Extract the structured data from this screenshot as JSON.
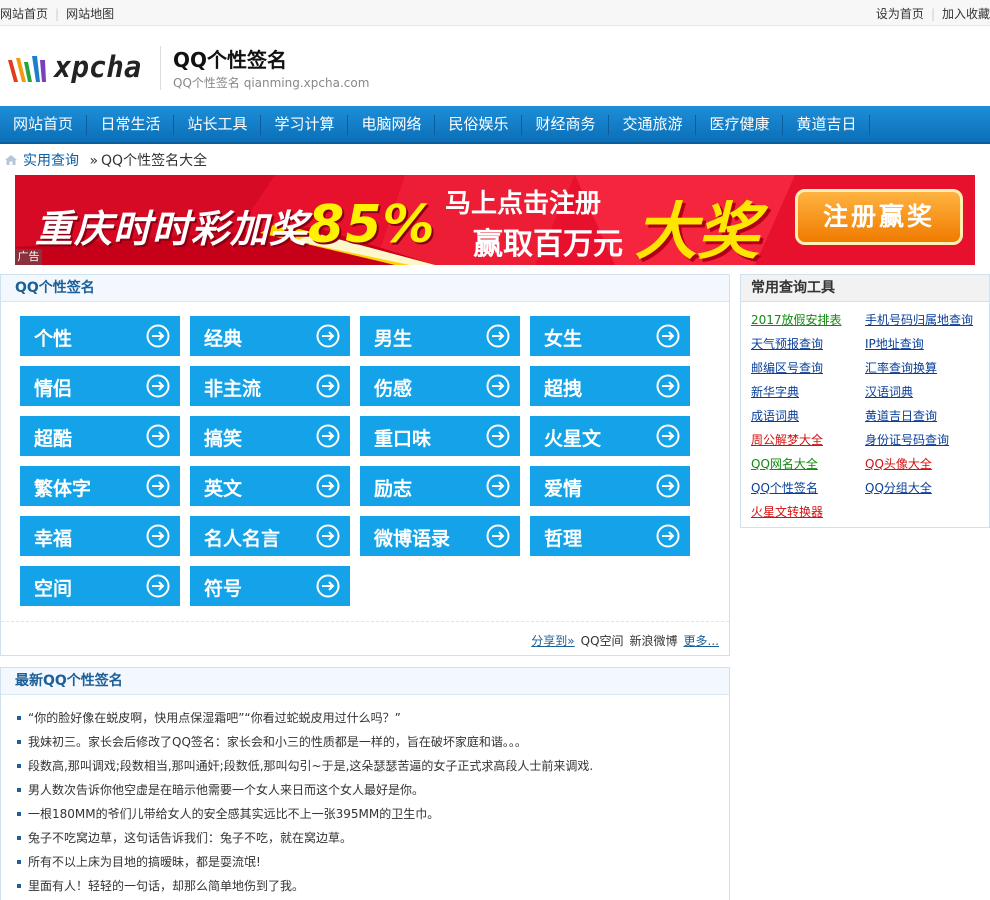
{
  "topbar": {
    "home": "网站首页",
    "sitemap": "网站地图",
    "set_home": "设为首页",
    "favorite": "加入收藏"
  },
  "header": {
    "logo_text": "xpcha",
    "title": "QQ个性签名",
    "subtitle": "QQ个性签名 qianming.xpcha.com"
  },
  "nav": [
    "网站首页",
    "日常生活",
    "站长工具",
    "学习计算",
    "电脑网络",
    "民俗娱乐",
    "财经商务",
    "交通旅游",
    "医疗健康",
    "黄道吉日"
  ],
  "breadcrumb": {
    "root": "实用查询",
    "separator": "»",
    "current": "QQ个性签名大全"
  },
  "ad": {
    "tag": "广告",
    "line1_a": "重庆时时彩加奖",
    "line1_b": "85%",
    "line2": "马上点击注册",
    "line3": "赢取百万元",
    "big": "大奖",
    "button": "注册赢奖"
  },
  "categories_box": {
    "title": "QQ个性签名",
    "items": [
      "个性",
      "经典",
      "男生",
      "女生",
      "情侣",
      "非主流",
      "伤感",
      "超拽",
      "超酷",
      "搞笑",
      "重口味",
      "火星文",
      "繁体字",
      "英文",
      "励志",
      "爱情",
      "幸福",
      "名人名言",
      "微博语录",
      "哲理",
      "空间",
      "符号"
    ],
    "share_to": "分享到»",
    "share_qzone": "QQ空间",
    "share_weibo": "新浪微博",
    "more": "更多..."
  },
  "tools": {
    "title": "常用查询工具",
    "links": [
      {
        "label": "2017放假安排表",
        "color": "#118a11"
      },
      {
        "label": "手机号码归属地查询",
        "color": "#0a3f99"
      },
      {
        "label": "天气预报查询",
        "color": "#0a3f99"
      },
      {
        "label": "IP地址查询",
        "color": "#0a3f99"
      },
      {
        "label": "邮编区号查询",
        "color": "#0a3f99"
      },
      {
        "label": "汇率查询换算",
        "color": "#0a3f99"
      },
      {
        "label": "新华字典",
        "color": "#0a3f99"
      },
      {
        "label": "汉语词典",
        "color": "#0a3f99"
      },
      {
        "label": "成语词典",
        "color": "#0a3f99"
      },
      {
        "label": "黄道吉日查询",
        "color": "#0a3f99"
      },
      {
        "label": "周公解梦大全",
        "color": "#d41111"
      },
      {
        "label": "身份证号码查询",
        "color": "#0a3f99"
      },
      {
        "label": "QQ网名大全",
        "color": "#118a11"
      },
      {
        "label": "QQ头像大全",
        "color": "#d41111"
      },
      {
        "label": "QQ个性签名",
        "color": "#0a3f99"
      },
      {
        "label": "QQ分组大全",
        "color": "#0a3f99"
      },
      {
        "label": "火星文转换器",
        "color": "#d41111"
      }
    ]
  },
  "latest": {
    "title": "最新QQ个性签名",
    "items": [
      "“你的脸好像在蜕皮啊，快用点保湿霜吧”“你看过蛇蜕皮用过什么吗？”",
      "我妹初三。家长会后修改了QQ签名：家长会和小三的性质都是一样的，旨在破坏家庭和谐。。。",
      "段数高,那叫调戏;段数相当,那叫通奸;段数低,那叫勾引~于是,这朵瑟瑟苦逼的女子正式求高段人士前来调戏.",
      "男人数次告诉你他空虚是在暗示他需要一个女人来日而这个女人最好是你。",
      "一根180MM的爷们儿带给女人的安全感其实远比不上一张395MM的卫生巾。",
      "兔子不吃窝边草，这句话告诉我们：兔子不吃，就在窝边草。",
      "所有不以上床为目地的搞暧昧，都是耍流氓!",
      "里面有人！轻轻的一句话，却那么简单地伤到了我。"
    ]
  },
  "colors": {
    "nav_blue": "#0a6fb8",
    "category_blue": "#14a3e8",
    "box_title_blue": "#1d5f98",
    "ad_red": "#e8112d",
    "ad_yellow": "#ffe600"
  }
}
